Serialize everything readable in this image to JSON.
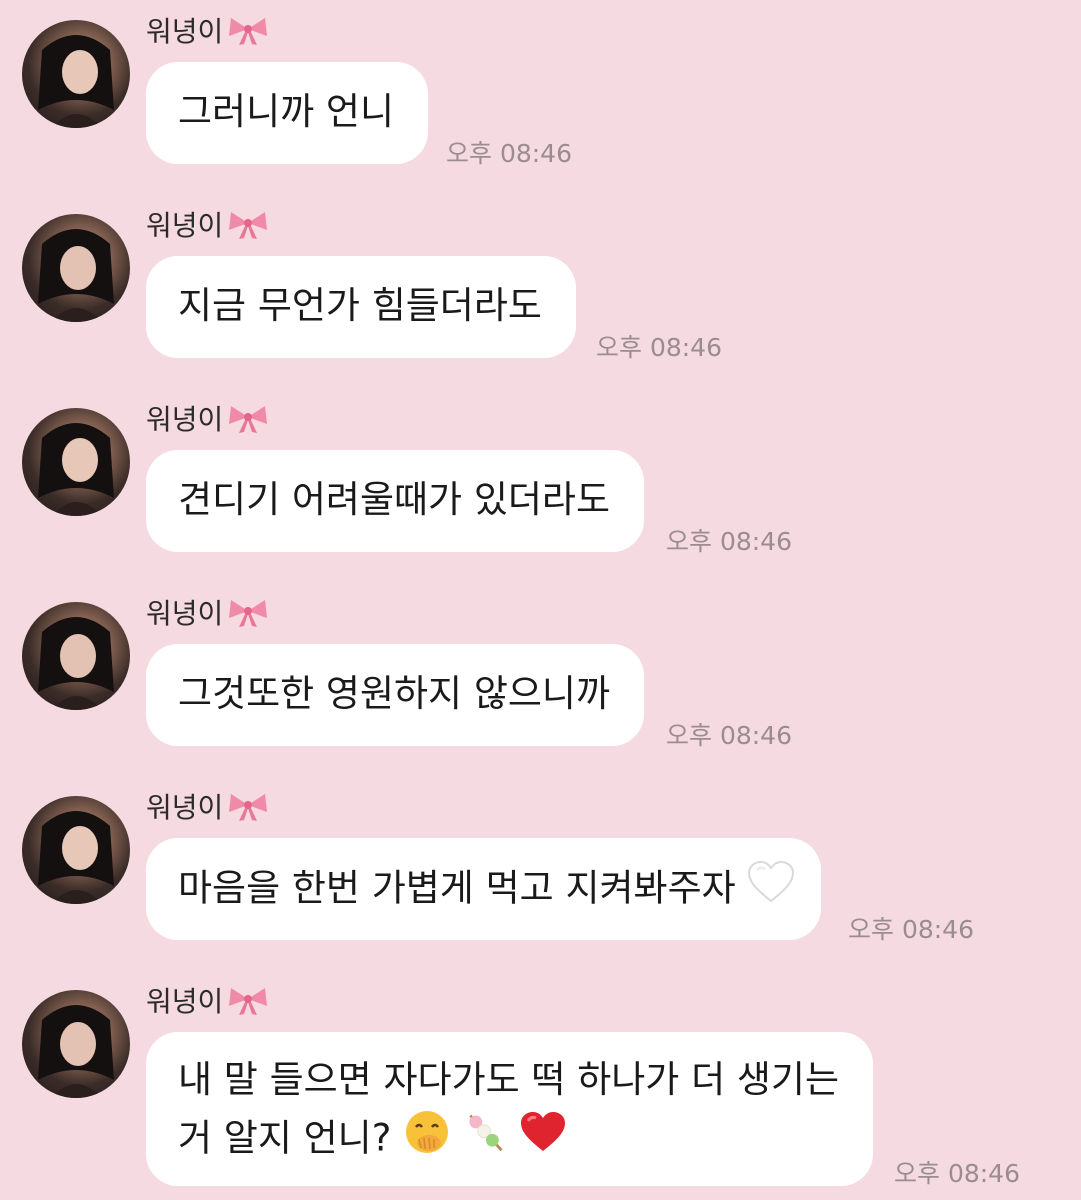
{
  "chat": {
    "messages": [
      {
        "sender": "워녕이",
        "text": "그러니까 언니",
        "time": "오후 08:46"
      },
      {
        "sender": "워녕이",
        "text": "지금 무언가 힘들더라도",
        "time": "오후 08:46"
      },
      {
        "sender": "워녕이",
        "text": "견디기 어려울때가 있더라도",
        "time": "오후 08:46"
      },
      {
        "sender": "워녕이",
        "text": "그것또한 영원하지 않으니까",
        "time": "오후 08:46"
      },
      {
        "sender": "워녕이",
        "text": "마음을 한번 가볍게 먹고 지켜봐주자",
        "time": "오후 08:46"
      },
      {
        "sender": "워녕이",
        "text_line1": "내 말 들으면 자다가도 떡 하나가 더 생기는",
        "text_line2": "거 알지 언니?",
        "time": "오후 08:46"
      }
    ]
  },
  "icons": {
    "sender_badge": "ribbon-bow-icon",
    "msg5_trailing": "white-heart-icon",
    "msg6_trailing": [
      "face-with-hand-over-mouth-icon",
      "dango-icon",
      "red-heart-icon"
    ]
  },
  "colors": {
    "background": "#f5dbe1",
    "bubble": "#ffffff",
    "timestamp": "#9a8c90",
    "bow": "#f08aa8",
    "red_heart": "#e0242f"
  }
}
